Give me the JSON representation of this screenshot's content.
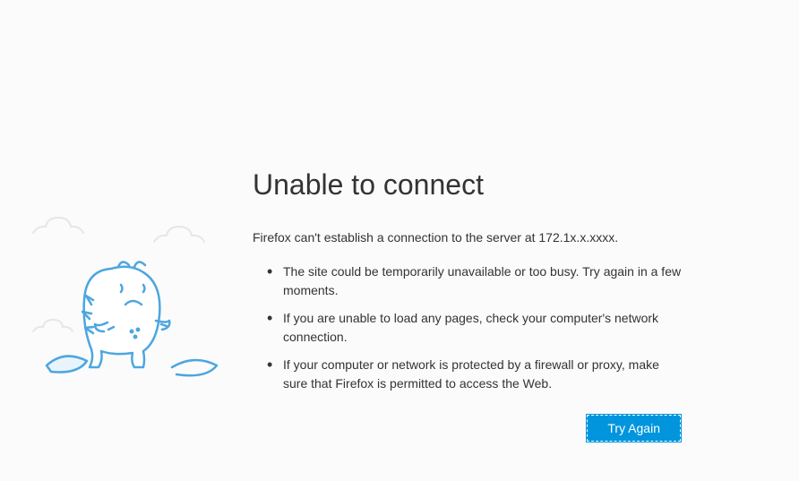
{
  "error": {
    "title": "Unable to connect",
    "description": "Firefox can't establish a connection to the server at 172.1x.x.xxxx.",
    "bullets": [
      "The site could be temporarily unavailable or too busy. Try again in a few moments.",
      "If you are unable to load any pages, check your computer's network connection.",
      "If your computer or network is protected by a firewall or proxy, make sure that Firefox is permitted to access the Web."
    ],
    "button_label": "Try Again"
  }
}
